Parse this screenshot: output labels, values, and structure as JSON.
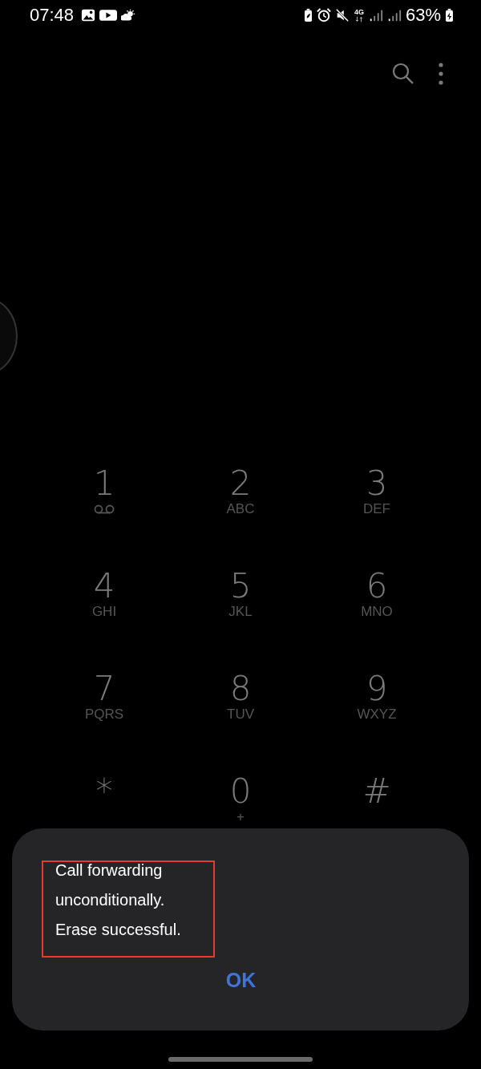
{
  "status_bar": {
    "time": "07:48",
    "network": "4G",
    "battery": "63%"
  },
  "keypad": [
    {
      "digit": "1",
      "kind": "voicemail"
    },
    {
      "digit": "2",
      "kind": "letters",
      "sub": "ABC"
    },
    {
      "digit": "3",
      "kind": "letters",
      "sub": "DEF"
    },
    {
      "digit": "4",
      "kind": "letters",
      "sub": "GHI"
    },
    {
      "digit": "5",
      "kind": "letters",
      "sub": "JKL"
    },
    {
      "digit": "6",
      "kind": "letters",
      "sub": "MNO"
    },
    {
      "digit": "7",
      "kind": "letters",
      "sub": "PQRS"
    },
    {
      "digit": "8",
      "kind": "letters",
      "sub": "TUV"
    },
    {
      "digit": "9",
      "kind": "letters",
      "sub": "WXYZ"
    },
    {
      "digit": "*",
      "kind": "plain"
    },
    {
      "digit": "0",
      "kind": "letters",
      "sub": "+"
    },
    {
      "digit": "#",
      "kind": "plain"
    }
  ],
  "dialog": {
    "message": [
      "Call forwarding",
      "unconditionally.",
      "Erase successful."
    ],
    "highlighted": true,
    "button": "OK"
  }
}
